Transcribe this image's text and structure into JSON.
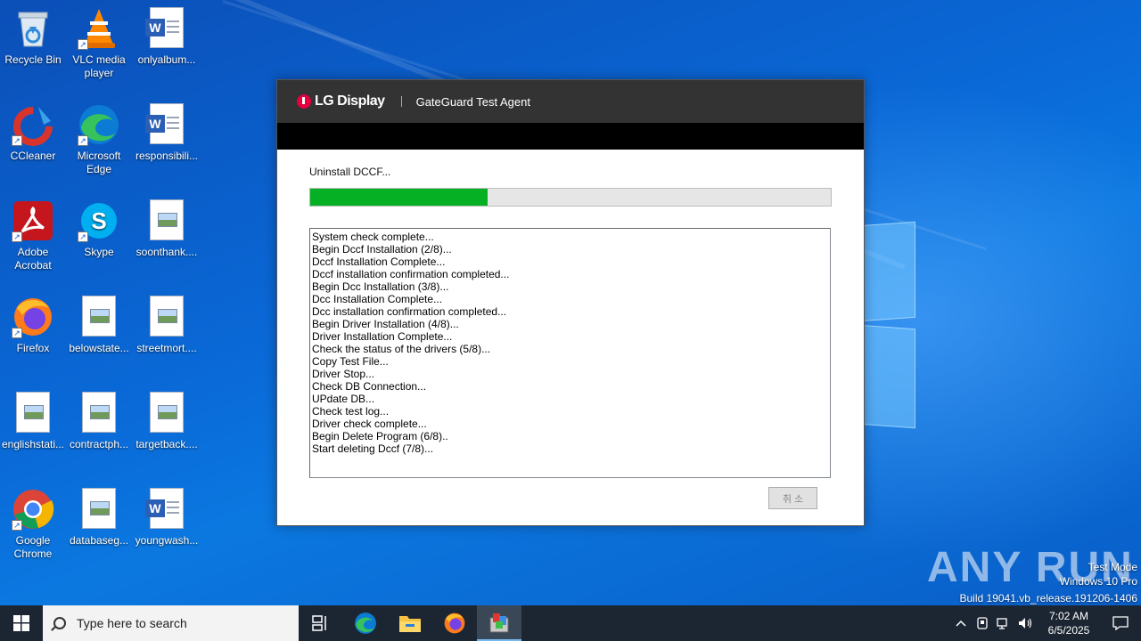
{
  "desktop": {
    "icons": [
      {
        "label": "Recycle Bin",
        "icon": "recycle-bin-icon"
      },
      {
        "label": "VLC media player",
        "icon": "vlc-icon"
      },
      {
        "label": "onlyalbum...",
        "icon": "word-doc-icon"
      },
      {
        "label": "CCleaner",
        "icon": "ccleaner-icon"
      },
      {
        "label": "Microsoft Edge",
        "icon": "edge-icon"
      },
      {
        "label": "responsibili...",
        "icon": "word-doc-icon"
      },
      {
        "label": "Adobe Acrobat",
        "icon": "acrobat-icon"
      },
      {
        "label": "Skype",
        "icon": "skype-icon"
      },
      {
        "label": "soonthank....",
        "icon": "image-file-icon"
      },
      {
        "label": "Firefox",
        "icon": "firefox-icon"
      },
      {
        "label": "belowstate...",
        "icon": "image-file-icon"
      },
      {
        "label": "streetmort....",
        "icon": "image-file-icon"
      },
      {
        "label": "englishstati...",
        "icon": "image-file-icon"
      },
      {
        "label": "contractph...",
        "icon": "image-file-icon"
      },
      {
        "label": "targetback....",
        "icon": "image-file-icon"
      },
      {
        "label": "Google Chrome",
        "icon": "chrome-icon"
      },
      {
        "label": "databaseg...",
        "icon": "image-file-icon"
      },
      {
        "label": "youngwash...",
        "icon": "word-doc-icon"
      }
    ]
  },
  "app": {
    "brand": "LG Display",
    "title": "GateGuard Test Agent",
    "status_text": "Uninstall DCCF...",
    "progress": 0.34,
    "log_lines": [
      "System check complete...",
      "Begin Dccf Installation (2/8)...",
      "Dccf Installation Complete...",
      "Dccf installation confirmation completed...",
      "Begin Dcc Installation (3/8)...",
      "Dcc Installation Complete...",
      "Dcc installation confirmation completed...",
      "Begin Driver Installation (4/8)...",
      "Driver Installation Complete...",
      "Check the status of the drivers (5/8)...",
      "Copy Test File...",
      "Driver Stop...",
      "Check DB Connection...",
      "UPdate DB...",
      "Check test log...",
      "Driver check complete...",
      "Begin Delete Program (6/8)..",
      "Start deleting Dccf (7/8)..."
    ],
    "cancel_label": "취 소"
  },
  "watermark": {
    "brand": "ANY RUN",
    "mode": "Test Mode",
    "os": "Windows 10 Pro",
    "build": "Build 19041.vb_release.191206-1406"
  },
  "taskbar": {
    "search_placeholder": "Type here to search",
    "time": "7:02 AM",
    "date": "6/5/2025"
  },
  "colors": {
    "progress_fill": "#06b025",
    "header_bg": "#333333",
    "taskbar_bg": "#1c2632"
  }
}
